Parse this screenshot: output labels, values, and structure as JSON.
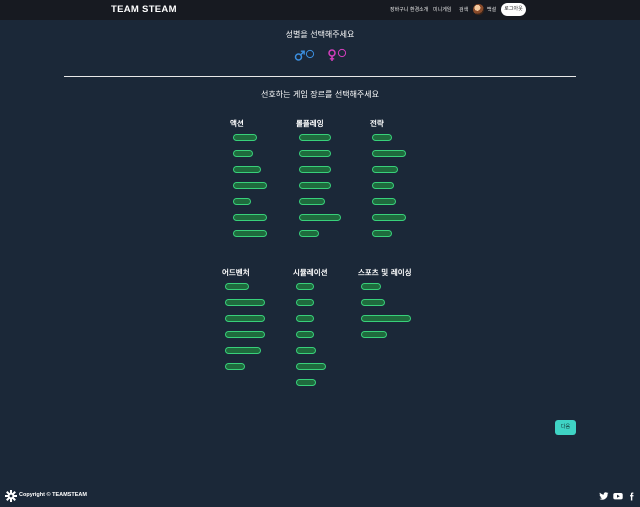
{
  "header": {
    "brand": "TEAM STEAM",
    "nav": [
      "장바구니 환경",
      "소개",
      "미니게임",
      "검색"
    ],
    "username": "백설",
    "logout_label": "로그아웃"
  },
  "gender_section": {
    "title": "성별을 선택해주세요",
    "male_color": "#3b8fe0",
    "female_color": "#d63fbf"
  },
  "genre_section": {
    "title": "선호하는 게임 장르를 선택해주세요",
    "groups": [
      {
        "name": "액션",
        "tag_count": 7
      },
      {
        "name": "롤플레잉",
        "tag_count": 7
      },
      {
        "name": "전략",
        "tag_count": 7
      },
      {
        "name": "어드벤처",
        "tag_count": 6
      },
      {
        "name": "시뮬레이션",
        "tag_count": 7
      },
      {
        "name": "스포츠 및 레이싱",
        "tag_count": 4
      }
    ]
  },
  "next_label": "다음",
  "footer": {
    "copyright": "Copyright © TEAMSTEAM"
  },
  "colors": {
    "background": "#1b2838",
    "topbar": "#171a21",
    "tag_border": "#38d07a",
    "next_button": "#3fd3c4"
  }
}
